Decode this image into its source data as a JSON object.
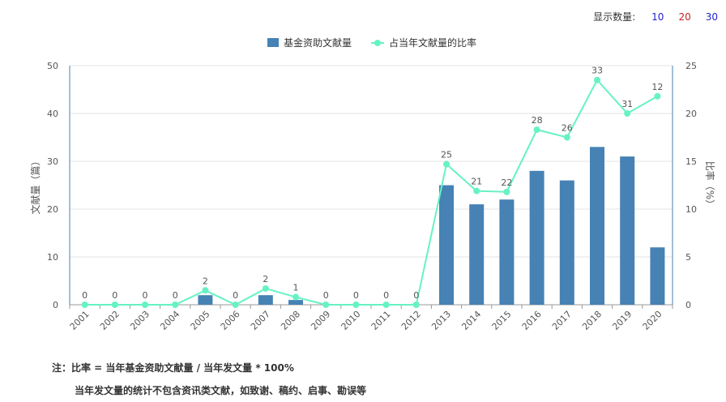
{
  "controls": {
    "display_count_label": "显示数量:",
    "options": [
      {
        "label": "10",
        "color": "#2222cc"
      },
      {
        "label": "20",
        "color": "#cc2222"
      },
      {
        "label": "30",
        "color": "#2222cc"
      }
    ]
  },
  "chart_data": {
    "type": "bar",
    "categories": [
      "2001",
      "2002",
      "2003",
      "2004",
      "2005",
      "2006",
      "2007",
      "2008",
      "2009",
      "2010",
      "2011",
      "2012",
      "2013",
      "2014",
      "2015",
      "2016",
      "2017",
      "2018",
      "2019",
      "2020"
    ],
    "series": [
      {
        "name": "基金资助文献量",
        "type": "bar",
        "axis": "left",
        "color": "#4682b4",
        "values": [
          0,
          0,
          0,
          0,
          2,
          0,
          2,
          1,
          0,
          0,
          0,
          0,
          25,
          21,
          22,
          28,
          26,
          33,
          31,
          12
        ]
      },
      {
        "name": "占当年文献量的比率",
        "type": "line",
        "axis": "right",
        "color": "#66f2c4",
        "values": [
          0,
          0,
          0,
          0,
          1.5,
          0,
          1.7,
          0.8,
          0,
          0,
          0,
          0,
          14.7,
          11.9,
          11.8,
          18.3,
          17.5,
          23.5,
          20.0,
          21.8
        ]
      }
    ],
    "ylabel_left": "文献量（篇）",
    "ylabel_right": "比率（%）",
    "ylim_left": [
      0,
      50
    ],
    "ylim_right": [
      0,
      25
    ],
    "yticks_left": [
      "0",
      "10",
      "20",
      "30",
      "40",
      "50"
    ],
    "yticks_right": [
      "0",
      "5",
      "10",
      "15",
      "20",
      "25"
    ],
    "grid": true,
    "legend_position": "top-center"
  },
  "notes": {
    "line1": "注：比率 = 当年基金资助文献量 / 当年发文量 * 100%",
    "line2": "当年发文量的统计不包含资讯类文献，如致谢、稿约、启事、勘误等"
  }
}
